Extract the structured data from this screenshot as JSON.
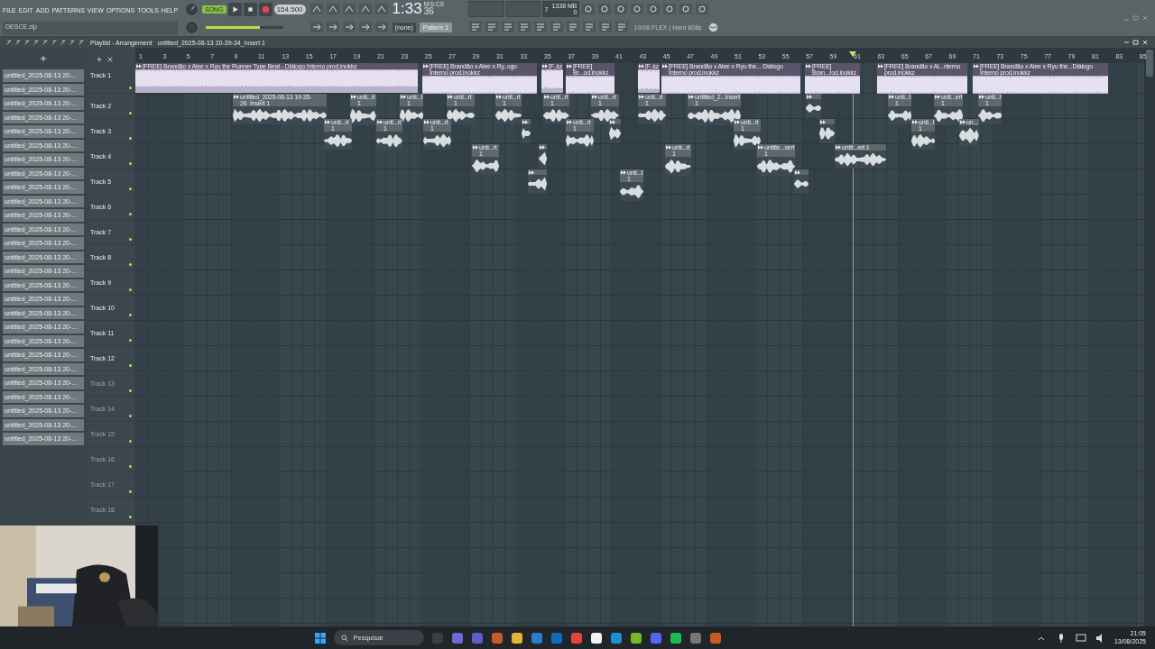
{
  "menu": [
    "FILE",
    "EDIT",
    "ADD",
    "PATTERNS",
    "VIEW",
    "OPTIONS",
    "TOOLS",
    "HELP"
  ],
  "hint": "DESCE.zip",
  "transport": {
    "mode": "SONG",
    "song_mode": true,
    "tempo": "154.500",
    "time": "1:33",
    "time_sub": "36",
    "time_unit": "M:S:CS"
  },
  "master_volume": {
    "level": 0.7
  },
  "memory": {
    "voices": "7",
    "ram": "1338 MB",
    "cpu": "0"
  },
  "pattern": {
    "snap": "(none)",
    "name": "Pattern 1"
  },
  "hint_right": "10/08  FLEX | Hard 808s",
  "breadcrumb": [
    "Playlist - Arrangement",
    "untitled_2025-08-13 20-39-34_Insert 1"
  ],
  "ruler": [
    "1",
    "3",
    "5",
    "7",
    "9",
    "11",
    "13",
    "15",
    "17",
    "19",
    "21",
    "23",
    "25",
    "27",
    "29",
    "31",
    "33",
    "35",
    "37",
    "39",
    "41",
    "43",
    "45",
    "47",
    "49",
    "51",
    "53",
    "55",
    "57",
    "59",
    "61",
    "63",
    "65",
    "67",
    "69",
    "71",
    "73",
    "75",
    "77",
    "79",
    "81",
    "83",
    "85"
  ],
  "browser": [
    "untitled_2025-08-13 20-...",
    "untitled_2025-08-13 20-...",
    "untitled_2025-08-13 20-...",
    "untitled_2025-08-13 20-...",
    "untitled_2025-08-13 20-...",
    "untitled_2025-08-13 20-...",
    "untitled_2025-08-13 20-...",
    "untitled_2025-08-13 20-...",
    "untitled_2025-08-13 20-...",
    "untitled_2025-08-13 20-...",
    "untitled_2025-08-13 20-...",
    "untitled_2025-08-13 20-...",
    "untitled_2025-08-13 20-...",
    "untitled_2025-08-13 20-...",
    "untitled_2025-08-13 20-...",
    "untitled_2025-08-13 20-...",
    "untitled_2025-08-13 20-...",
    "untitled_2025-08-13 20-...",
    "untitled_2025-08-13 20-...",
    "untitled_2025-08-13 20-...",
    "untitled_2025-08-13 20-...",
    "untitled_2025-08-13 20-...",
    "untitled_2025-08-13 20-...",
    "untitled_2025-08-13 20-...",
    "untitled_2025-08-13 20-...",
    "untitled_2025-08-13 20-...",
    "untitled_2025-08-13 20-..."
  ],
  "tracks": [
    {
      "name": "Track 1",
      "dimmed": false,
      "clips": [
        {
          "label": "[FREE] Brandão x Alee x Ryu the Runner Type Beat -  Diálogo Interno   prod.inokkz",
          "color": "#b9b0cc"
        },
        {
          "label": "[FREE] Brandão x Alee x Ry..ogo Interno  prod.inokkz",
          "color": "#b9b0cc"
        },
        {
          "label": "[F..kz",
          "color": "#b9b0cc"
        },
        {
          "label": "[FREE] Br...od.inokkz",
          "color": "#b9b0cc"
        },
        {
          "label": "[F..kz",
          "color": "#b9b0cc"
        },
        {
          "label": "[FREE] Brandão x Alee x Ryu the...  Diálogo Interno   prod.inokkz",
          "color": "#b9b0cc"
        },
        {
          "label": "[FREE] Bran...rod.inokkz",
          "color": "#b9b0cc"
        },
        {
          "label": "[FREE] Brandão x Al...nterno   prod.inokkz",
          "color": "#b9b0cc"
        },
        {
          "label": "[FREE] Brandão x Alee x Ryu the...Diálogo Interno   prod.inokkz",
          "color": "#b9b0cc"
        }
      ]
    },
    {
      "name": "Track 2",
      "dimmed": false,
      "clips": [
        {
          "label": "untitled_2025-08-13 19-35-26_Insert 1",
          "color": "#3d4a51"
        },
        {
          "label": "unti...rt 1",
          "color": "#3d4a51"
        },
        {
          "label": "unti...t 1",
          "color": "#3d4a51"
        },
        {
          "label": "unti...rt 1",
          "color": "#3d4a51"
        },
        {
          "label": "unti...rt 1",
          "color": "#3d4a51"
        },
        {
          "label": "unti...rt 1",
          "color": "#3d4a51"
        },
        {
          "label": "unti...rt 1",
          "color": "#3d4a51"
        },
        {
          "label": "unti...rt 1",
          "color": "#3d4a51"
        },
        {
          "label": "untitled_2...Insert 1",
          "color": "#3d4a51"
        },
        {
          "color": "#3d4a51"
        },
        {
          "label": "unti...t 1",
          "color": "#3d4a51"
        },
        {
          "label": "unti...ert 1",
          "color": "#3d4a51"
        },
        {
          "label": "unti...t 1",
          "color": "#3d4a51"
        }
      ]
    },
    {
      "name": "Track 3",
      "dimmed": false,
      "clips": [
        {
          "label": "unti...rt 1",
          "color": "#3d4a51"
        },
        {
          "label": "unti...rt 1",
          "color": "#3d4a51"
        },
        {
          "label": "unti...rt 1",
          "color": "#3d4a51"
        },
        {
          "color": "#3d4a51"
        },
        {
          "label": "unti...rt 1",
          "color": "#3d4a51"
        },
        {
          "color": "#3d4a51"
        },
        {
          "label": "unti...rt 1",
          "color": "#3d4a51"
        },
        {
          "color": "#3d4a51"
        },
        {
          "label": "unti...t 1",
          "color": "#3d4a51"
        },
        {
          "label": "un...",
          "color": "#3d4a51"
        }
      ]
    },
    {
      "name": "Track 4",
      "dimmed": false,
      "clips": [
        {
          "label": "unti...rt 1",
          "color": "#3d4a51"
        },
        {
          "color": "#3d4a51"
        },
        {
          "label": "unti...rt 1",
          "color": "#3d4a51"
        },
        {
          "label": "untitle...sert 1",
          "color": "#3d4a51"
        },
        {
          "label": "untit...ert 1",
          "color": "#3d4a51"
        }
      ]
    },
    {
      "name": "Track 5",
      "dimmed": false,
      "clips": [
        {
          "color": "#3d4a51"
        },
        {
          "label": "unti...t 1",
          "color": "#3d4a51"
        },
        {
          "color": "#3d4a51"
        }
      ]
    },
    {
      "name": "Track 6",
      "dimmed": false
    },
    {
      "name": "Track 7",
      "dimmed": false
    },
    {
      "name": "Track 8",
      "dimmed": false
    },
    {
      "name": "Track 9",
      "dimmed": false
    },
    {
      "name": "Track 10",
      "dimmed": false
    },
    {
      "name": "Track 11",
      "dimmed": false
    },
    {
      "name": "Track 12",
      "dimmed": false
    },
    {
      "name": "Track 13",
      "dimmed": true
    },
    {
      "name": "Track 14",
      "dimmed": true
    },
    {
      "name": "Track 15",
      "dimmed": true
    },
    {
      "name": "Track 16",
      "dimmed": true
    },
    {
      "name": "Track 17",
      "dimmed": true
    },
    {
      "name": "Track 18",
      "dimmed": true
    }
  ],
  "taskbar": {
    "search": "Pesquisar",
    "time": "21:05",
    "date": "13/08/2025"
  }
}
